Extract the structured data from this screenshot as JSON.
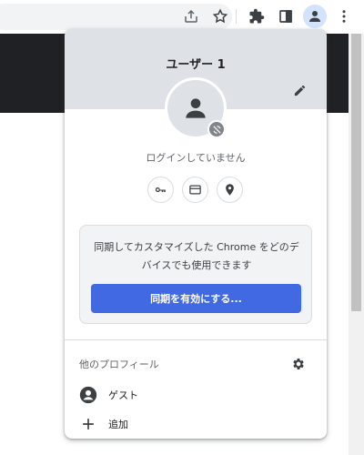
{
  "toolbar": {
    "icons": [
      "share-icon",
      "bookmark-star-icon",
      "extensions-puzzle-icon",
      "side-panel-icon",
      "profile-icon",
      "more-vert-icon"
    ]
  },
  "profile_menu": {
    "name": "ユーザー 1",
    "status": "ログインしていません",
    "quick_actions": [
      "key-icon",
      "credit-card-icon",
      "location-pin-icon"
    ],
    "sync_card": {
      "description": "同期してカスタマイズした Chrome をどのデバイスでも使用できます",
      "button_label": "同期を有効にする..."
    },
    "other_profiles": {
      "label": "他のプロフィール",
      "items": [
        {
          "label": "ゲスト",
          "icon": "guest-avatar-icon"
        },
        {
          "label": "追加",
          "icon": "plus-icon"
        }
      ]
    }
  },
  "colors": {
    "header_bg": "#dee1e6",
    "primary_button": "#4169e1",
    "card_bg": "#f1f3f4",
    "icon": "#5f6368"
  }
}
